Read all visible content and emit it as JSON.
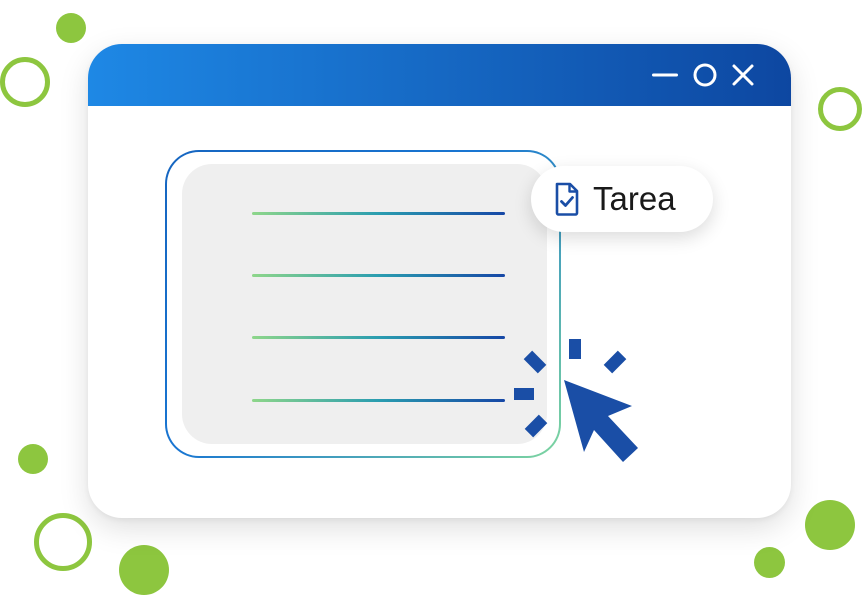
{
  "window": {
    "controls": {
      "minimize_icon": "minimize-icon",
      "maximize_icon": "maximize-icon",
      "close_icon": "close-icon"
    },
    "titlebar_colors": [
      "#1e88e5",
      "#0d47a1"
    ]
  },
  "chip": {
    "label": "Tarea",
    "icon": "document-check-icon"
  },
  "card": {
    "lines": 4
  },
  "cursor": {
    "icon": "pointer-click-icon",
    "color": "#1a4ea6"
  },
  "colors": {
    "accent_green": "#8dc63f",
    "accent_blue": "#1565c0"
  }
}
